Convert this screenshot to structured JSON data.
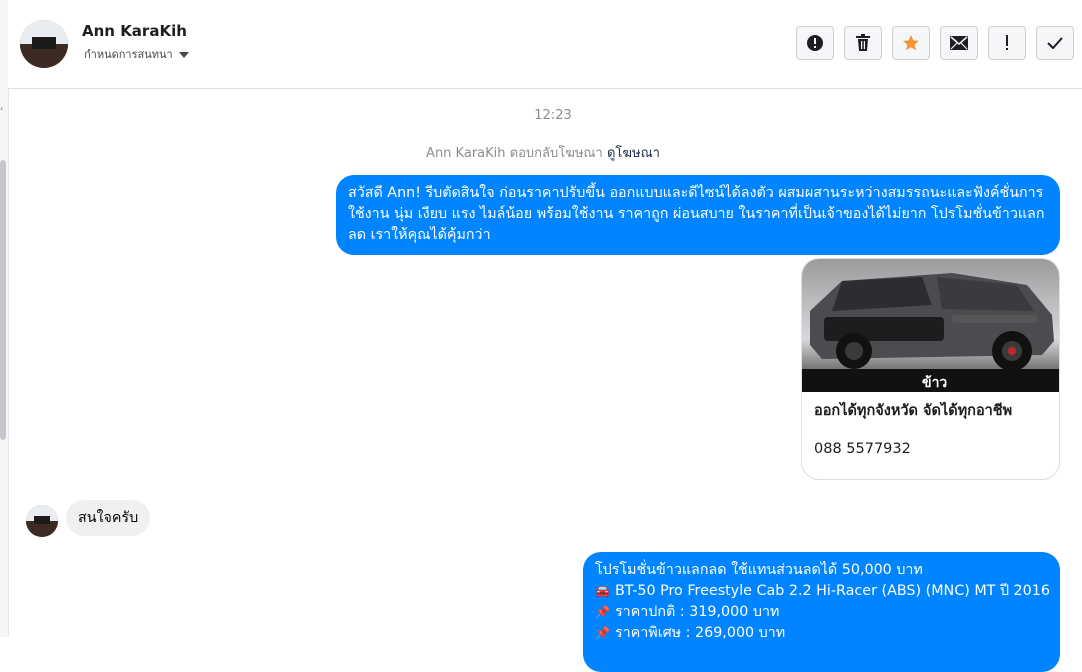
{
  "header": {
    "name": "Ann KaraKih",
    "subtitle": "กำหนดการสนทนา"
  },
  "actions": [
    {
      "name": "report",
      "icon": "alert-circle-icon"
    },
    {
      "name": "delete",
      "icon": "trash-icon"
    },
    {
      "name": "star",
      "icon": "star-icon",
      "color": "#f7923a"
    },
    {
      "name": "mark-unread",
      "icon": "envelope-icon"
    },
    {
      "name": "important",
      "icon": "exclamation-icon"
    },
    {
      "name": "done",
      "icon": "check-icon"
    }
  ],
  "conversation": {
    "timestamp": "12:23",
    "ad_reply": {
      "text": "Ann KaraKih ตอบกลับโฆษณา",
      "link": "ดูโฆษณา"
    },
    "messages": [
      {
        "direction": "outgoing",
        "text": "สวัสดี Ann! รีบตัดสินใจ ก่อนราคาปรับขึ้น ออกแบบและดีไซน์ได้ลงตัว ผสมผสานระหว่างสมรรถนะและฟังค์ชั่นการใช้งาน นุ่ม เงียบ แรง ไมล์น้อย พร้อมใช้งาน ราคาถูก ผ่อนสบาย ในราคาที่เป็นเจ้าของได้ไม่ยาก โปรโมชั่นข้าวแลกลด เราให้คุณได้คุ้มกว่า"
      },
      {
        "direction": "outgoing",
        "type": "card",
        "image_watermark": "ข้าว",
        "title": "ออกได้ทุกจังหวัด จัดได้ทุกอาชีพ",
        "phone": "088 5577932"
      },
      {
        "direction": "incoming",
        "text": "สนใจครับ"
      },
      {
        "direction": "outgoing",
        "lines": [
          {
            "emoji": "",
            "text": "โปรโมชั่นข้าวแลกลด ใช้แทนส่วนลดได้ 50,000 บาท"
          },
          {
            "emoji": "car-icon",
            "text": "BT-50 Pro Freestyle Cab 2.2 Hi-Racer (ABS) (MNC) MT ปี 2016"
          },
          {
            "emoji": "pin-icon",
            "text": "ราคาปกติ : 319,000 บาท"
          },
          {
            "emoji": "pin-icon",
            "text": "ราคาพิเศษ : 269,000 บาท"
          }
        ]
      }
    ]
  },
  "colors": {
    "accent": "#0084ff",
    "incoming_bubble": "#f1f0f0",
    "star": "#f7923a"
  }
}
